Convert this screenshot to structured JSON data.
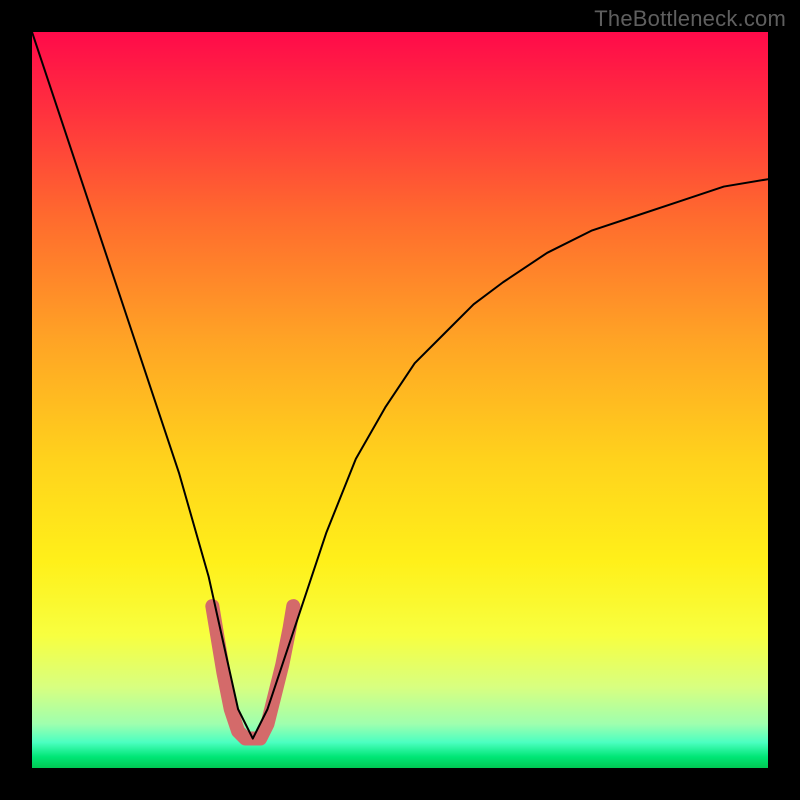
{
  "watermark": "TheBottleneck.com",
  "chart_data": {
    "type": "line",
    "title": "",
    "xlabel": "",
    "ylabel": "",
    "xlim": [
      0,
      100
    ],
    "ylim": [
      0,
      100
    ],
    "curve_main": {
      "name": "bottleneck-curve",
      "color": "#000000",
      "thickness": 2,
      "x": [
        0,
        4,
        8,
        12,
        16,
        20,
        24,
        26,
        28,
        30,
        32,
        36,
        40,
        44,
        48,
        52,
        56,
        60,
        64,
        70,
        76,
        82,
        88,
        94,
        100
      ],
      "y": [
        100,
        88,
        76,
        64,
        52,
        40,
        26,
        17,
        8,
        4,
        8,
        20,
        32,
        42,
        49,
        55,
        59,
        63,
        66,
        70,
        73,
        75,
        77,
        79,
        80
      ]
    },
    "curve_accent": {
      "name": "optimal-zone",
      "color": "#d46a6a",
      "thickness": 14,
      "x": [
        24.5,
        25,
        26,
        27,
        28,
        29,
        30,
        31,
        32,
        33,
        34,
        35,
        35.5
      ],
      "y": [
        22,
        19,
        13,
        8,
        5,
        4,
        4,
        4,
        6,
        10,
        14,
        19,
        22
      ]
    },
    "gradient_stops": [
      {
        "offset": 0.0,
        "color": "#ff0a4a"
      },
      {
        "offset": 0.1,
        "color": "#ff2e3f"
      },
      {
        "offset": 0.25,
        "color": "#ff6a2e"
      },
      {
        "offset": 0.42,
        "color": "#ffa425"
      },
      {
        "offset": 0.58,
        "color": "#ffd21c"
      },
      {
        "offset": 0.72,
        "color": "#fff01a"
      },
      {
        "offset": 0.82,
        "color": "#f7ff40"
      },
      {
        "offset": 0.89,
        "color": "#d8ff80"
      },
      {
        "offset": 0.94,
        "color": "#9fffae"
      },
      {
        "offset": 0.965,
        "color": "#4cffc1"
      },
      {
        "offset": 0.985,
        "color": "#00e676"
      },
      {
        "offset": 1.0,
        "color": "#00c853"
      }
    ]
  }
}
